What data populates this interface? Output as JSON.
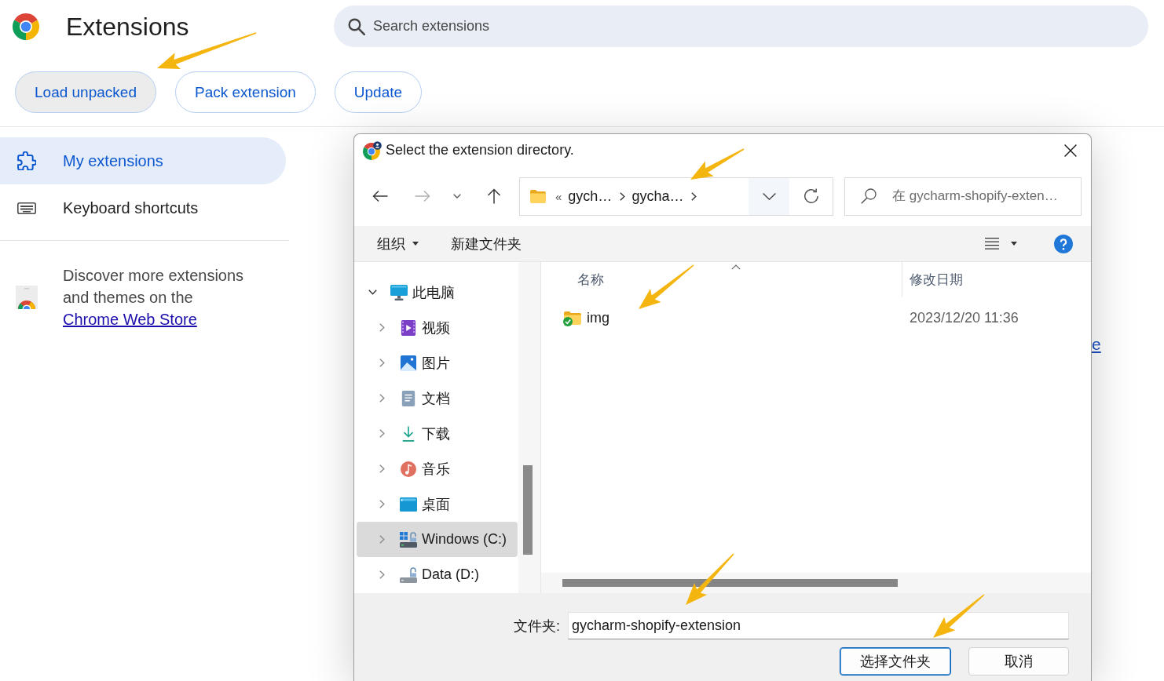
{
  "header": {
    "title": "Extensions",
    "search": {
      "placeholder": "Search extensions"
    }
  },
  "toolbar_buttons": [
    {
      "label": "Load unpacked",
      "hovered": true
    },
    {
      "label": "Pack extension",
      "hovered": false
    },
    {
      "label": "Update",
      "hovered": false
    }
  ],
  "sidebar": {
    "items": [
      {
        "label": "My extensions",
        "kind": "extensions",
        "selected": true
      },
      {
        "label": "Keyboard shortcuts",
        "kind": "keyboard",
        "selected": false
      }
    ],
    "promo": {
      "text": "Discover more extensions and themes on the ",
      "link": "Chrome Web Store"
    }
  },
  "main": {
    "link_fragment": "e"
  },
  "dialog": {
    "title": "Select the extension directory.",
    "nav_buttons": [
      {
        "kind": "back",
        "disabled": false
      },
      {
        "kind": "forward",
        "disabled": true
      },
      {
        "kind": "recent",
        "disabled": false
      },
      {
        "kind": "up",
        "disabled": false
      }
    ],
    "address": {
      "overflow": "«",
      "segments": [
        "gych…",
        "gycha…"
      ]
    },
    "search": {
      "placeholder": "在 gycharm-shopify-exten…"
    },
    "commands": [
      {
        "label": "组织",
        "kind": "menu"
      },
      {
        "label": "新建文件夹",
        "kind": "button"
      }
    ],
    "tree": [
      {
        "label": "此电脑",
        "kind": "pc",
        "expanded": true,
        "selected": false,
        "children": [
          {
            "label": "视频",
            "kind": "videos",
            "expanded": false,
            "selected": false
          },
          {
            "label": "图片",
            "kind": "pictures",
            "expanded": false,
            "selected": false
          },
          {
            "label": "文档",
            "kind": "documents",
            "expanded": false,
            "selected": false
          },
          {
            "label": "下载",
            "kind": "downloads",
            "expanded": false,
            "selected": false
          },
          {
            "label": "音乐",
            "kind": "music",
            "expanded": false,
            "selected": false
          },
          {
            "label": "桌面",
            "kind": "desktop",
            "expanded": false,
            "selected": false
          },
          {
            "label": "Windows (C:)",
            "kind": "system-drive",
            "expanded": false,
            "selected": true
          },
          {
            "label": "Data (D:)",
            "kind": "drive",
            "expanded": false,
            "selected": false
          }
        ]
      }
    ],
    "columns": [
      {
        "label": "名称",
        "sorted": true
      },
      {
        "label": "修改日期",
        "sorted": false
      }
    ],
    "files": [
      {
        "name": "img",
        "kind": "folder",
        "synced": true,
        "modified": "2023/12/20 11:36"
      }
    ],
    "folder_field": {
      "label": "文件夹:",
      "value": "gycharm-shopify-extension"
    },
    "buttons": [
      {
        "label": "选择文件夹",
        "default": true
      },
      {
        "label": "取消",
        "default": false
      }
    ]
  }
}
